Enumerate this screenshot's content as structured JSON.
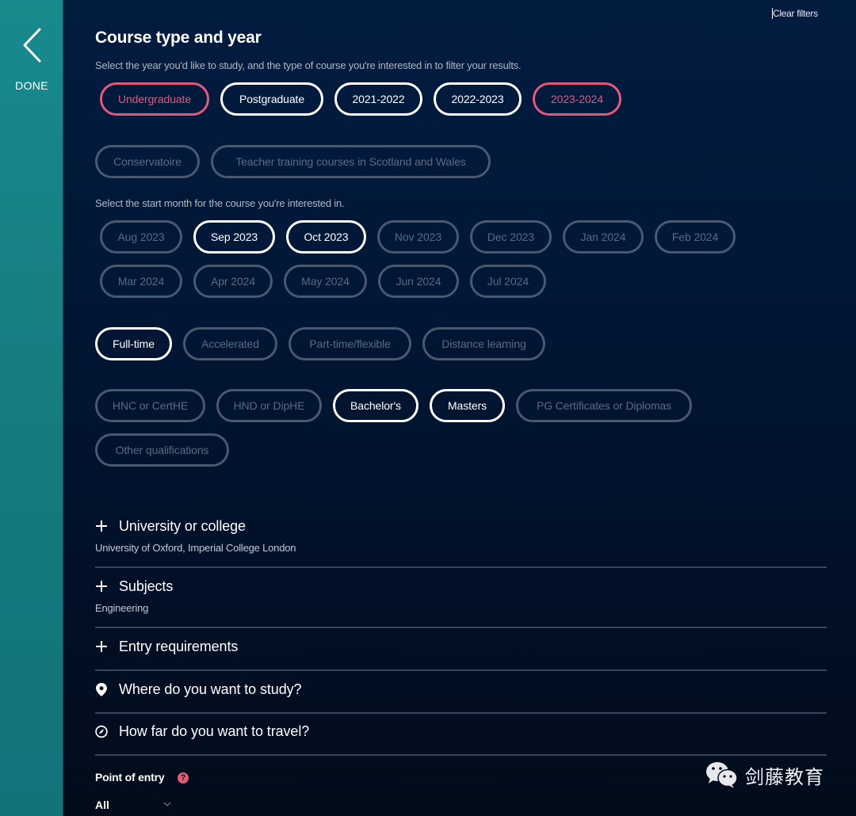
{
  "sidebar": {
    "back_icon": "chevron-left-icon",
    "done_label": "DONE"
  },
  "header": {
    "clear_filters": "Clear filters"
  },
  "course_type": {
    "title": "Course type and year",
    "description": "Select the year you'd like to study, and the type of course you're interested in to filter your results.",
    "level_and_year": [
      {
        "label": "Undergraduate",
        "state": "highlighted"
      },
      {
        "label": "Postgraduate",
        "state": "selected"
      },
      {
        "label": "2021-2022",
        "state": "selected"
      },
      {
        "label": "2022-2023",
        "state": "selected"
      },
      {
        "label": "2023-2024",
        "state": "highlighted"
      }
    ],
    "special_types": [
      {
        "label": "Conservatoire",
        "state": "disabled"
      },
      {
        "label": "Teacher training courses in Scotland and Wales",
        "state": "disabled"
      }
    ],
    "month_description": "Select the start month for the course you're interested in.",
    "months_row1": [
      {
        "label": "Aug 2023",
        "state": "disabled"
      },
      {
        "label": "Sep 2023",
        "state": "selected"
      },
      {
        "label": "Oct 2023",
        "state": "selected"
      },
      {
        "label": "Nov 2023",
        "state": "disabled"
      },
      {
        "label": "Dec 2023",
        "state": "disabled"
      },
      {
        "label": "Jan 2024",
        "state": "disabled"
      },
      {
        "label": "Feb 2024",
        "state": "disabled"
      }
    ],
    "months_row2": [
      {
        "label": "Mar 2024",
        "state": "disabled"
      },
      {
        "label": "Apr 2024",
        "state": "disabled"
      },
      {
        "label": "May 2024",
        "state": "disabled"
      },
      {
        "label": "Jun 2024",
        "state": "disabled"
      },
      {
        "label": "Jul 2024",
        "state": "disabled"
      }
    ],
    "study_modes": [
      {
        "label": "Full-time",
        "state": "selected"
      },
      {
        "label": "Accelerated",
        "state": "disabled"
      },
      {
        "label": "Part-time/flexible",
        "state": "disabled"
      },
      {
        "label": "Distance learning",
        "state": "disabled"
      }
    ],
    "qualifications_row1": [
      {
        "label": "HNC or CertHE",
        "state": "disabled"
      },
      {
        "label": "HND or DipHE",
        "state": "disabled"
      },
      {
        "label": "Bachelor's",
        "state": "selected"
      },
      {
        "label": "Masters",
        "state": "selected"
      },
      {
        "label": "PG Certificates or Diplomas",
        "state": "disabled"
      }
    ],
    "qualifications_row2": [
      {
        "label": "Other qualifications",
        "state": "disabled"
      }
    ]
  },
  "accordions": {
    "university": {
      "icon": "plus-icon",
      "title": "University or college",
      "value": "University of Oxford, Imperial College London"
    },
    "subjects": {
      "icon": "plus-icon",
      "title": "Subjects",
      "value": "Engineering"
    },
    "entry": {
      "icon": "plus-icon",
      "title": "Entry requirements"
    },
    "where": {
      "icon": "map-pin-icon",
      "title": "Where do you want to study?"
    },
    "travel": {
      "icon": "compass-icon",
      "title": "How far do you want to travel?"
    }
  },
  "point_of_entry": {
    "label": "Point of entry",
    "help_icon": "?",
    "selected": "All"
  },
  "watermark": {
    "icon": "wechat-icon",
    "text": "剑藤教育"
  },
  "colors": {
    "sidebar": "#178a8d",
    "background": "#011a3c",
    "accent_pink": "#e4587a",
    "selected_border": "#ffffff",
    "disabled_border": "#4a5870"
  }
}
